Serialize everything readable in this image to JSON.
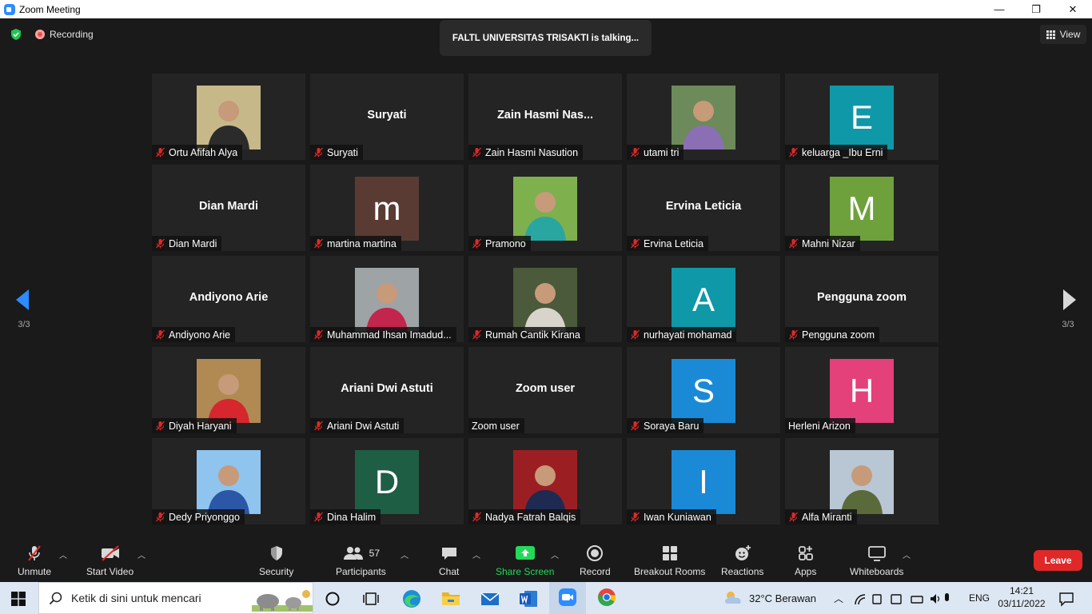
{
  "window": {
    "title": "Zoom Meeting",
    "min": "—",
    "max": "❐",
    "close": "✕"
  },
  "top": {
    "recording": "Recording",
    "talking": "FALTL UNIVERSITAS TRISAKTI is talking...",
    "view": "View"
  },
  "nav": {
    "page_left": "3/3",
    "page_right": "3/3"
  },
  "participants": [
    {
      "label": "Ortu Afifah Alya",
      "type": "photo",
      "muted": true,
      "colors": [
        "#c7b88a",
        "#2b2b2b"
      ]
    },
    {
      "label": "Suryati",
      "type": "name",
      "big": "Suryati",
      "muted": true
    },
    {
      "label": "Zain Hasmi Nasution",
      "type": "name",
      "big": "Zain Hasmi Nas...",
      "muted": true
    },
    {
      "label": "utami tri",
      "type": "photo",
      "muted": true,
      "colors": [
        "#6c8a5a",
        "#8b6fb5"
      ]
    },
    {
      "label": "keluarga _Ibu Erni",
      "type": "letter",
      "letter": "E",
      "bg": "#0e98a8",
      "muted": true
    },
    {
      "label": "Dian Mardi",
      "type": "name",
      "big": "Dian Mardi",
      "muted": true
    },
    {
      "label": "martina martina",
      "type": "letter",
      "letter": "m",
      "bg": "#5a3b34",
      "muted": true
    },
    {
      "label": "Pramono",
      "type": "photo",
      "muted": true,
      "colors": [
        "#7fb04e",
        "#2aa6a0"
      ]
    },
    {
      "label": "Ervina Leticia",
      "type": "name",
      "big": "Ervina Leticia",
      "muted": true
    },
    {
      "label": "Mahni Nizar",
      "type": "letter",
      "letter": "M",
      "bg": "#6ea13c",
      "muted": true
    },
    {
      "label": "Andiyono Arie",
      "type": "name",
      "big": "Andiyono Arie",
      "muted": true
    },
    {
      "label": "Muhammad Ihsan Imadud...",
      "type": "photo",
      "muted": true,
      "colors": [
        "#9ea3a6",
        "#c2264c"
      ]
    },
    {
      "label": "Rumah Cantik Kirana",
      "type": "photo",
      "muted": true,
      "colors": [
        "#4a5a3a",
        "#d9d4cb"
      ]
    },
    {
      "label": "nurhayati mohamad",
      "type": "letter",
      "letter": "A",
      "bg": "#0e98a8",
      "muted": true
    },
    {
      "label": "Pengguna zoom",
      "type": "name",
      "big": "Pengguna zoom",
      "muted": true
    },
    {
      "label": "Diyah Haryani",
      "type": "photo",
      "muted": true,
      "colors": [
        "#b08a52",
        "#d6262e"
      ]
    },
    {
      "label": "Ariani Dwi Astuti",
      "type": "name",
      "big": "Ariani Dwi Astuti",
      "muted": true
    },
    {
      "label": "Zoom user",
      "type": "name",
      "big": "Zoom user",
      "muted": false
    },
    {
      "label": "Soraya Baru",
      "type": "letter",
      "letter": "S",
      "bg": "#1b8ad6",
      "muted": true
    },
    {
      "label": "Herleni Arizon",
      "type": "letter",
      "letter": "H",
      "bg": "#e4407a",
      "muted": false
    },
    {
      "label": "Dedy Priyonggo",
      "type": "photo",
      "muted": true,
      "colors": [
        "#8fc4ee",
        "#2b57a6"
      ]
    },
    {
      "label": "Dina Halim",
      "type": "letter",
      "letter": "D",
      "bg": "#1e5e44",
      "muted": true
    },
    {
      "label": "Nadya Fatrah Balqis",
      "type": "photo",
      "muted": true,
      "colors": [
        "#9b1f22",
        "#1e2a52"
      ]
    },
    {
      "label": "Iwan Kuniawan",
      "type": "letter",
      "letter": "I",
      "bg": "#1b8ad6",
      "muted": true
    },
    {
      "label": "Alfa Miranti",
      "type": "photo",
      "muted": true,
      "colors": [
        "#b9c6d4",
        "#5b6a3a"
      ]
    }
  ],
  "toolbar": {
    "unmute": "Unmute",
    "start_video": "Start Video",
    "security": "Security",
    "participants": "Participants",
    "participants_count": "57",
    "chat": "Chat",
    "share_screen": "Share Screen",
    "record": "Record",
    "breakout": "Breakout Rooms",
    "reactions": "Reactions",
    "apps": "Apps",
    "whiteboards": "Whiteboards",
    "leave": "Leave",
    "share_color": "#23d959",
    "leave_color": "#e02828"
  },
  "taskbar": {
    "search_placeholder": "Ketik di sini untuk mencari",
    "weather": "32°C  Berawan",
    "lang": "ENG",
    "time": "14:21",
    "date": "03/11/2022"
  }
}
